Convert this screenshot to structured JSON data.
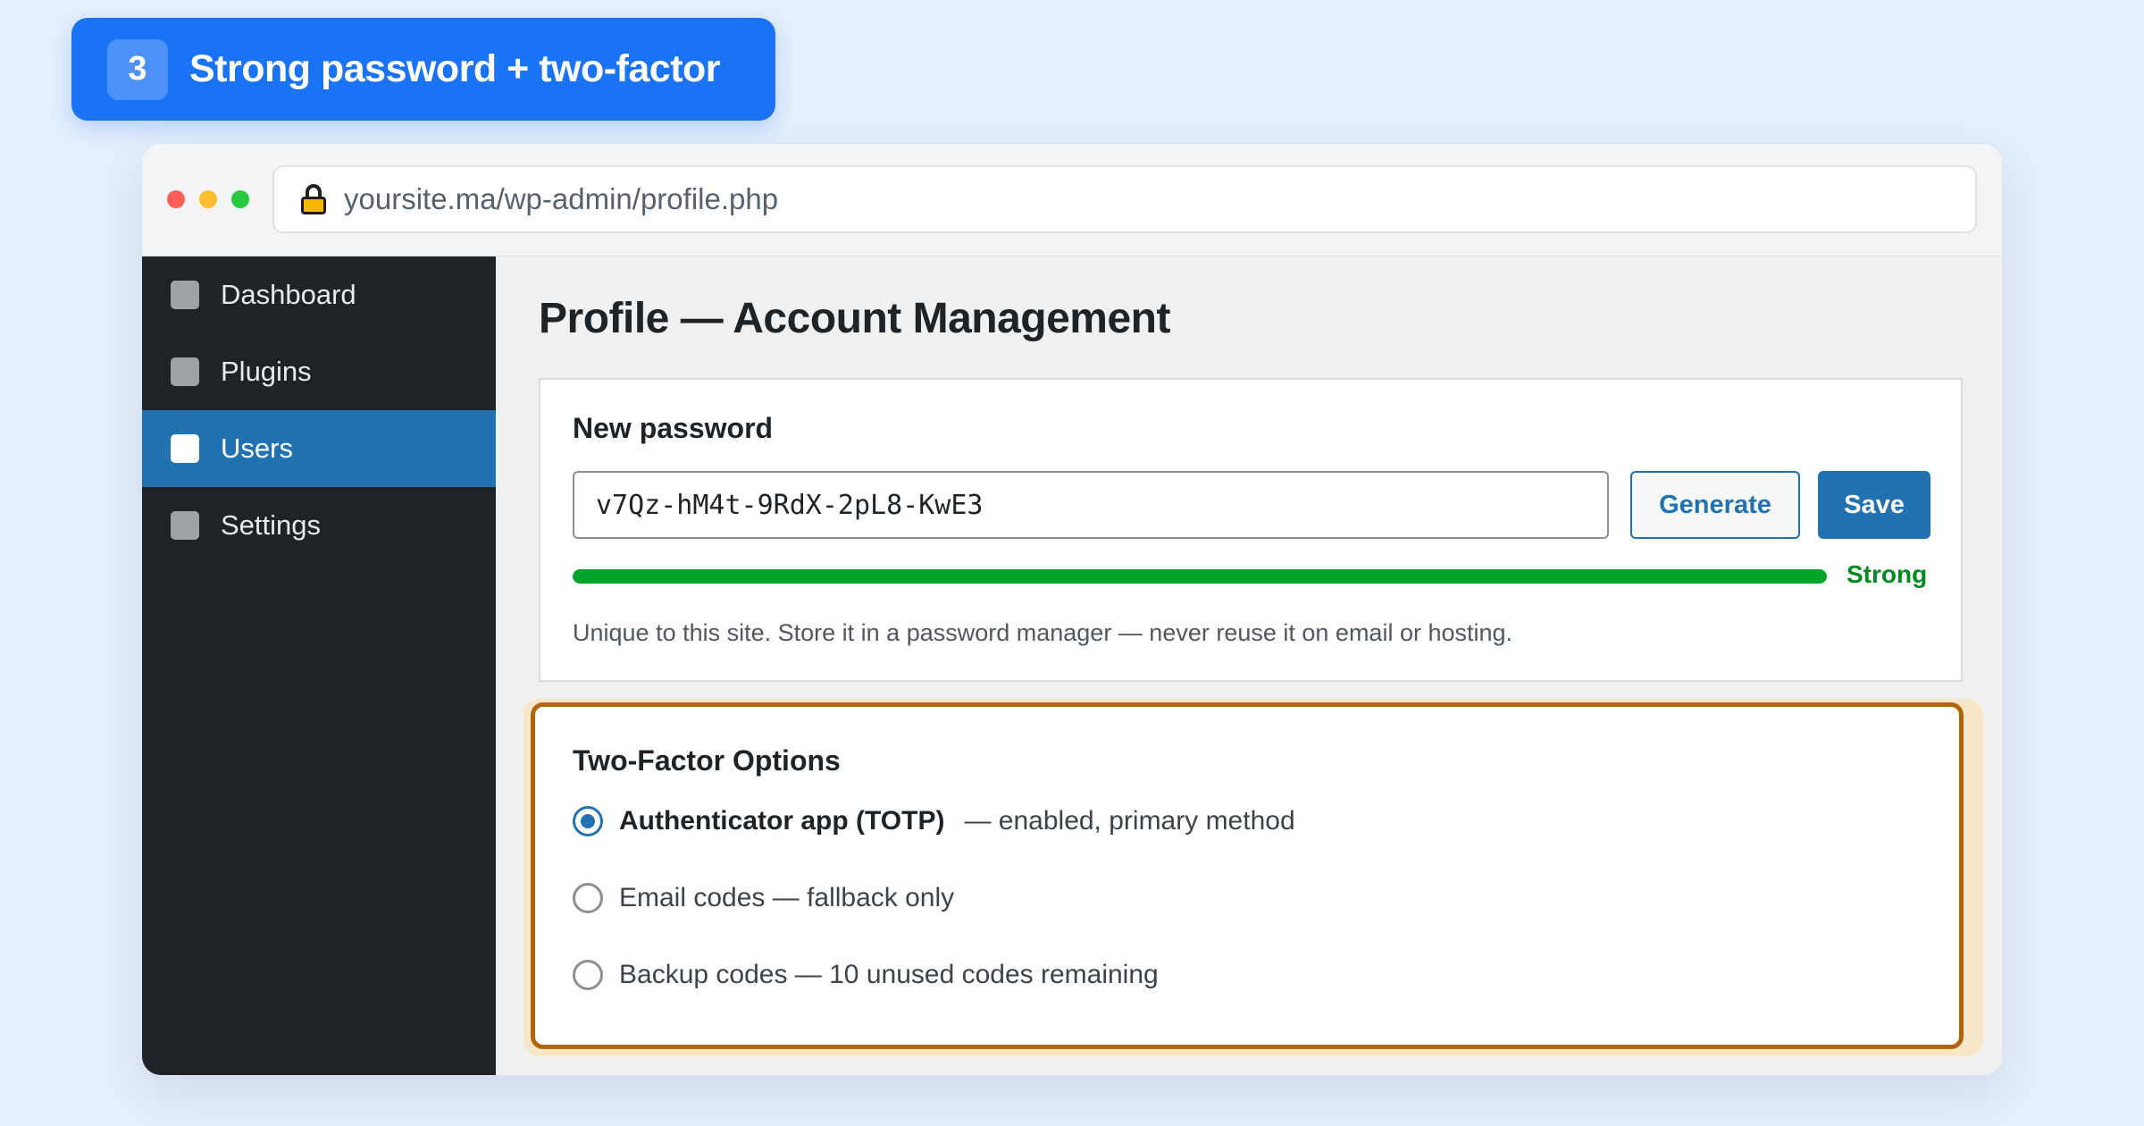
{
  "banner": {
    "step_number": "3",
    "title": "Strong password + two-factor"
  },
  "browser": {
    "url": "yoursite.ma/wp-admin/profile.php",
    "lock_icon": "lock-icon"
  },
  "sidebar": {
    "items": [
      {
        "label": "Dashboard",
        "active": false
      },
      {
        "label": "Plugins",
        "active": false
      },
      {
        "label": "Users",
        "active": true
      },
      {
        "label": "Settings",
        "active": false
      }
    ]
  },
  "main": {
    "page_title": "Profile — Account Management",
    "password": {
      "heading": "New password",
      "value": "v7Qz-hM4t-9RdX-2pL8-KwE3",
      "generate_label": "Generate",
      "save_label": "Save",
      "strength_label": "Strong",
      "strength_fraction": 1.0,
      "help_text": "Unique to this site. Store it in a password manager — never reuse it on email or hosting."
    },
    "two_factor": {
      "heading": "Two-Factor Options",
      "options": [
        {
          "strong": "Authenticator app (TOTP)",
          "text": "— enabled, primary method",
          "checked": true
        },
        {
          "strong": "",
          "text": "Email codes — fallback only",
          "checked": false
        },
        {
          "strong": "",
          "text": "Backup codes — 10 unused codes remaining",
          "checked": false
        }
      ]
    }
  },
  "colors": {
    "banner": "#1a72f5",
    "sidebar": "#1d2327",
    "active_nav": "#2271b1",
    "strength": "#00a32a",
    "highlight_border": "#b0660b"
  }
}
